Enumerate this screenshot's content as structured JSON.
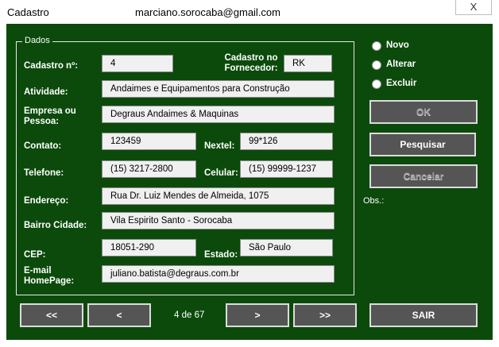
{
  "window": {
    "title": "Cadastro",
    "email": "marciano.sorocaba@gmail.com",
    "close_label": "X"
  },
  "frame": {
    "legend": "Dados"
  },
  "fields": {
    "cadastro_no": {
      "label": "Cadastro nº:",
      "value": "4"
    },
    "cadastro_fornecedor": {
      "label": "Cadastro no Fornecedor:",
      "value": "RK"
    },
    "atividade": {
      "label": "Atividade:",
      "value": "Andaimes e Equipamentos para Construção"
    },
    "empresa": {
      "label": "Empresa ou Pessoa:",
      "value": "Degraus Andaimes & Maquinas"
    },
    "contato": {
      "label": "Contato:",
      "value": "123459"
    },
    "nextel": {
      "label": "Nextel:",
      "value": "99*126"
    },
    "telefone": {
      "label": "Telefone:",
      "value": "(15) 3217-2800"
    },
    "celular": {
      "label": "Celular:",
      "value": "(15) 99999-1237"
    },
    "endereco": {
      "label": "Endereço:",
      "value": "Rua Dr. Luiz Mendes de Almeida, 1075"
    },
    "bairro_cidade": {
      "label": "Bairro Cidade:",
      "value": "Vila Espirito Santo - Sorocaba"
    },
    "cep": {
      "label": "CEP:",
      "value": "18051-290"
    },
    "estado": {
      "label": "Estado:",
      "value": "São Paulo"
    },
    "email": {
      "label": "E-mail HomePage:",
      "value": "juliano.batista@degraus.com.br"
    }
  },
  "options": {
    "novo": "Novo",
    "alterar": "Alterar",
    "excluir": "Excluir"
  },
  "buttons": {
    "ok": "OK",
    "pesquisar": "Pesquisar",
    "cancelar": "Cancelar",
    "sair": "SAIR",
    "first": "<<",
    "prev": "<",
    "next": ">",
    "last": ">>"
  },
  "obs_label": "Obs.:",
  "navigation": {
    "page_info": "4 de 67"
  }
}
